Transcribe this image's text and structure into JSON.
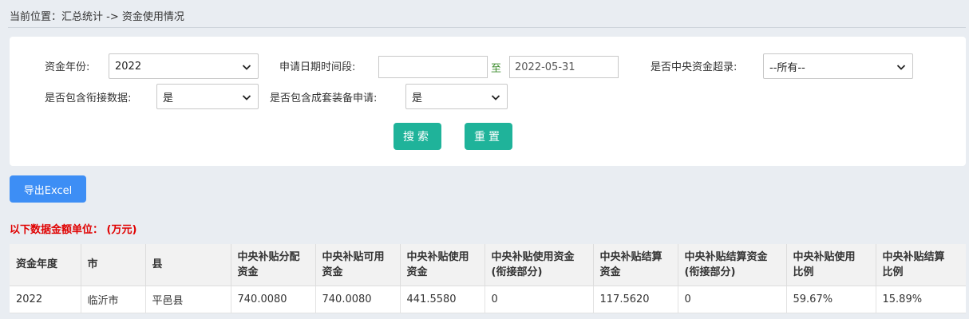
{
  "breadcrumb": "当前位置：汇总统计 -> 资金使用情况",
  "filters": {
    "year_label": "资金年份:",
    "year_value": "2022",
    "date_label": "申请日期时间段:",
    "date_from": "",
    "date_to_sep": "至",
    "date_to": "2022-05-31",
    "overrecord_label": "是否中央资金超录:",
    "overrecord_value": "--所有--",
    "linked_label": "是否包含衔接数据:",
    "linked_value": "是",
    "kit_label": "是否包含成套装备申请:",
    "kit_value": "是",
    "search_button": "搜索",
    "reset_button": "重置"
  },
  "export_button": "导出Excel",
  "unit_note": "以下数据金额单位：  (万元)",
  "table": {
    "headers": [
      [
        "资金年度",
        ""
      ],
      [
        "市",
        ""
      ],
      [
        "县",
        ""
      ],
      [
        "中央补贴分配",
        "资金"
      ],
      [
        "中央补贴可用",
        "资金"
      ],
      [
        "中央补贴使用",
        "资金"
      ],
      [
        "中央补贴使用资金",
        "(衔接部分)"
      ],
      [
        "中央补贴结算",
        "资金"
      ],
      [
        "中央补贴结算资金",
        "(衔接部分)"
      ],
      [
        "中央补贴使用",
        "比例"
      ],
      [
        "中央补贴结算",
        "比例"
      ]
    ],
    "rows": [
      [
        "2022",
        "临沂市",
        "平邑县",
        "740.0080",
        "740.0080",
        "441.5580",
        "0",
        "117.5620",
        "0",
        "59.67%",
        "15.89%"
      ]
    ]
  }
}
